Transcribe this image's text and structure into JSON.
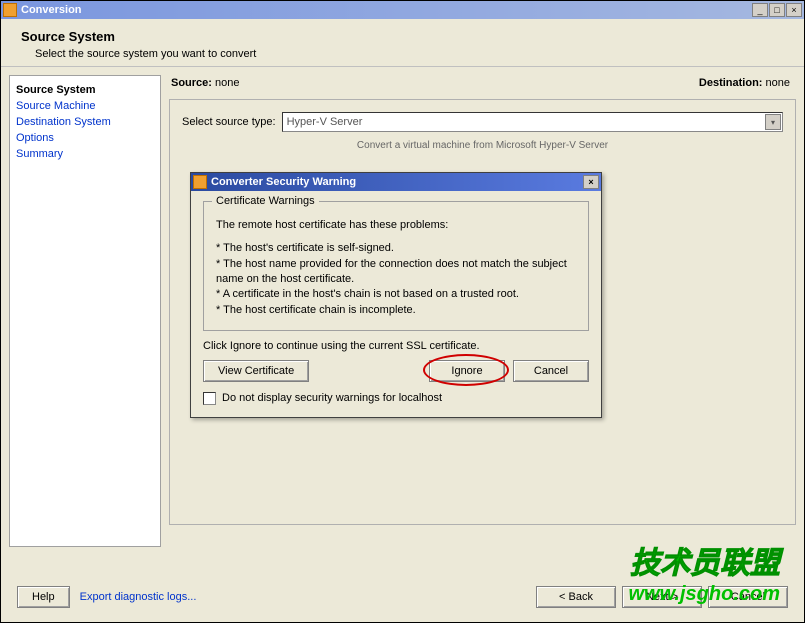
{
  "window": {
    "title": "Conversion",
    "minimize": "_",
    "maximize": "□",
    "close": "×"
  },
  "header": {
    "title": "Source System",
    "subtitle": "Select the source system you want to convert"
  },
  "sidebar": {
    "steps": [
      {
        "label": "Source System",
        "active": true
      },
      {
        "label": "Source Machine",
        "active": false
      },
      {
        "label": "Destination System",
        "active": false
      },
      {
        "label": "Options",
        "active": false
      },
      {
        "label": "Summary",
        "active": false
      }
    ]
  },
  "main": {
    "source_label": "Source:",
    "source_value": "none",
    "dest_label": "Destination:",
    "dest_value": "none",
    "select_label": "Select source type:",
    "select_value": "Hyper-V Server",
    "subtext": "Convert a virtual machine from Microsoft Hyper-V Server"
  },
  "footer": {
    "help_label": "Help",
    "export_label": "Export diagnostic logs...",
    "back_label": "< Back",
    "next_label": "Next >",
    "cancel_label": "Cancel"
  },
  "dialog": {
    "title": "Converter Security Warning",
    "close": "×",
    "group_title": "Certificate Warnings",
    "intro": "The remote host certificate has these problems:",
    "bullets": [
      "* The host's certificate is self-signed.",
      "* The host name provided for the connection does not match the subject name on the host certificate.",
      "* A certificate in the host's chain is not based on a trusted root.",
      "* The host certificate chain is incomplete."
    ],
    "instruction": "Click Ignore to continue using the current SSL certificate.",
    "view_cert_label": "View Certificate",
    "ignore_label": "Ignore",
    "cancel_label": "Cancel",
    "checkbox_label": "Do not display security warnings for localhost"
  },
  "watermarks": {
    "cn": "技术员联盟",
    "url": "www.jsgho.com"
  }
}
